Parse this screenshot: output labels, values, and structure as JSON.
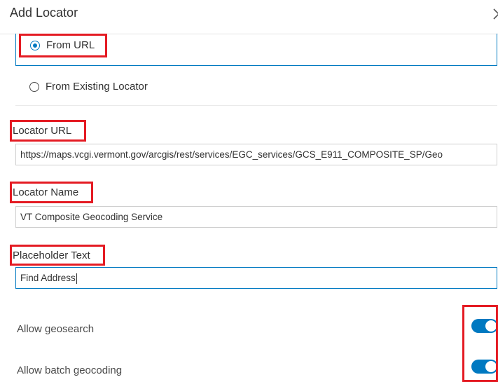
{
  "dialog": {
    "title": "Add Locator"
  },
  "source_options": {
    "from_url": {
      "label": "From URL",
      "selected": true
    },
    "from_existing": {
      "label": "From Existing Locator",
      "selected": false
    }
  },
  "fields": {
    "locator_url": {
      "label": "Locator URL",
      "value": "https://maps.vcgi.vermont.gov/arcgis/rest/services/EGC_services/GCS_E911_COMPOSITE_SP/Geo"
    },
    "locator_name": {
      "label": "Locator Name",
      "value": "VT Composite Geocoding Service"
    },
    "placeholder_text": {
      "label": "Placeholder Text",
      "value": "Find Address"
    }
  },
  "toggles": {
    "geosearch": {
      "label": "Allow geosearch",
      "enabled": true
    },
    "batch_geocoding": {
      "label": "Allow batch geocoding",
      "enabled": true
    }
  },
  "colors": {
    "accent": "#0079c1",
    "highlight": "#e41b23"
  }
}
